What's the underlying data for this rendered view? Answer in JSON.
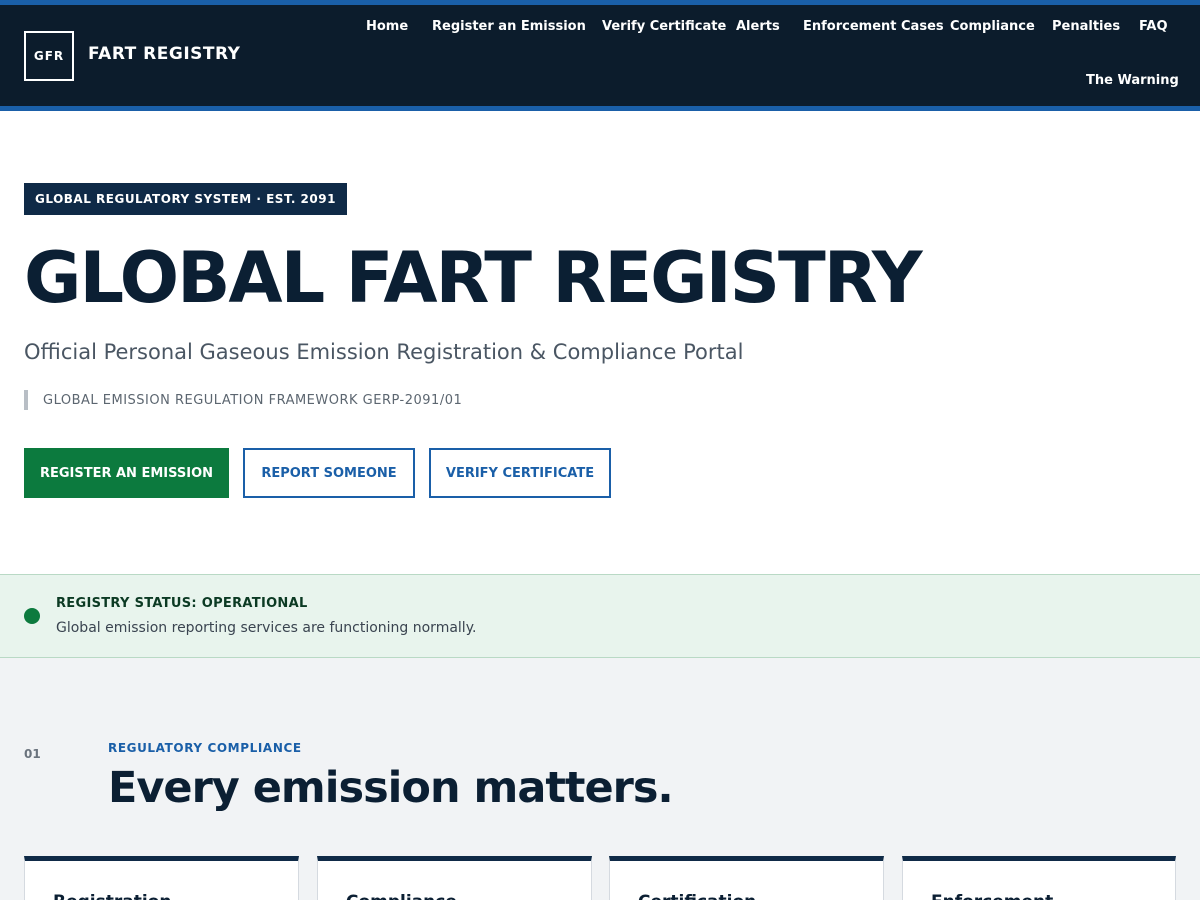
{
  "header": {
    "logo_text": "GFR",
    "brand": "FART REGISTRY",
    "nav": [
      "Home",
      "Register an Emission",
      "Verify Certificate",
      "Alerts",
      "Enforcement Cases",
      "Compliance",
      "Penalties",
      "FAQ",
      "The Warning"
    ]
  },
  "hero": {
    "eyebrow": "GLOBAL REGULATORY SYSTEM · EST. 2091",
    "title": "GLOBAL FART REGISTRY",
    "subtitle": "Official Personal Gaseous Emission Registration & Compliance Portal",
    "framework": "GLOBAL EMISSION REGULATION FRAMEWORK GERP-2091/01",
    "buttons": {
      "register": "REGISTER AN EMISSION",
      "report": "REPORT SOMEONE",
      "verify": "VERIFY CERTIFICATE"
    }
  },
  "status": {
    "title": "REGISTRY STATUS: OPERATIONAL",
    "text": "Global emission reporting services are functioning normally."
  },
  "section": {
    "number": "01",
    "eyebrow": "REGULATORY COMPLIANCE",
    "title": "Every emission matters.",
    "cards": [
      "Registration",
      "Compliance",
      "Certification",
      "Enforcement"
    ]
  },
  "colors": {
    "header_bg": "#0c1c2c",
    "accent_blue": "#1a5fa8",
    "primary_green": "#0c7a3e",
    "status_bg": "#e8f4ed",
    "section_bg": "#f1f3f5"
  }
}
